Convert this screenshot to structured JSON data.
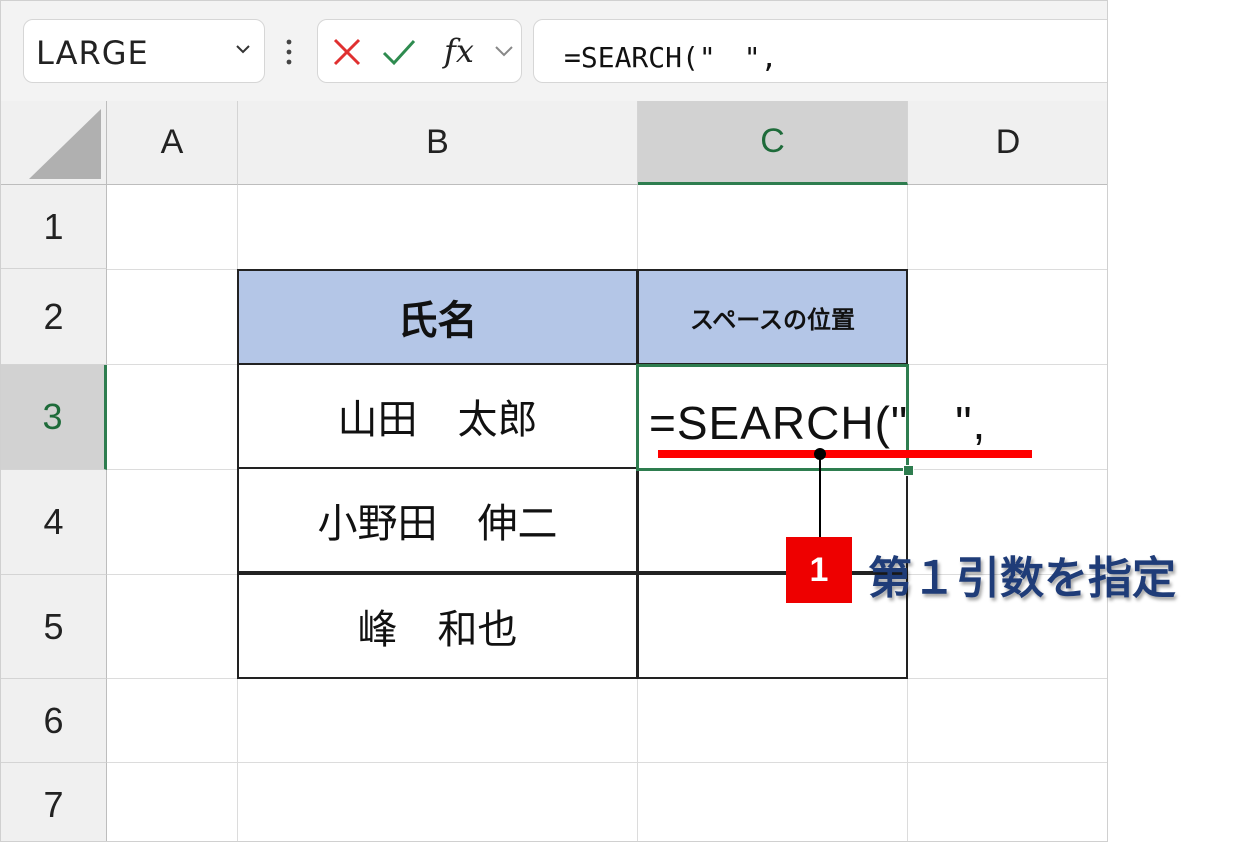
{
  "formula_bar": {
    "name_box": "LARGE",
    "cancel_icon": "close-icon",
    "enter_icon": "check-icon",
    "fx_label": "fx",
    "formula": "=SEARCH(\"　\","
  },
  "columns": [
    "A",
    "B",
    "C",
    "D"
  ],
  "rows": [
    "1",
    "2",
    "3",
    "4",
    "5",
    "6",
    "7"
  ],
  "table": {
    "header_name": "氏名",
    "header_position": "スペースの位置",
    "names": [
      "山田　太郎",
      "小野田　伸二",
      "峰　和也"
    ]
  },
  "active_cell": {
    "formula": "=SEARCH(\"　\","
  },
  "annotation": {
    "step_number": "1",
    "label": "第１引数を指定",
    "underline_color": "#ff0000",
    "badge_color": "#ee0000",
    "label_color": "#1f3c78"
  },
  "colors": {
    "header_fill": "#b4c6e7",
    "selection_green": "#2e7d4f"
  }
}
